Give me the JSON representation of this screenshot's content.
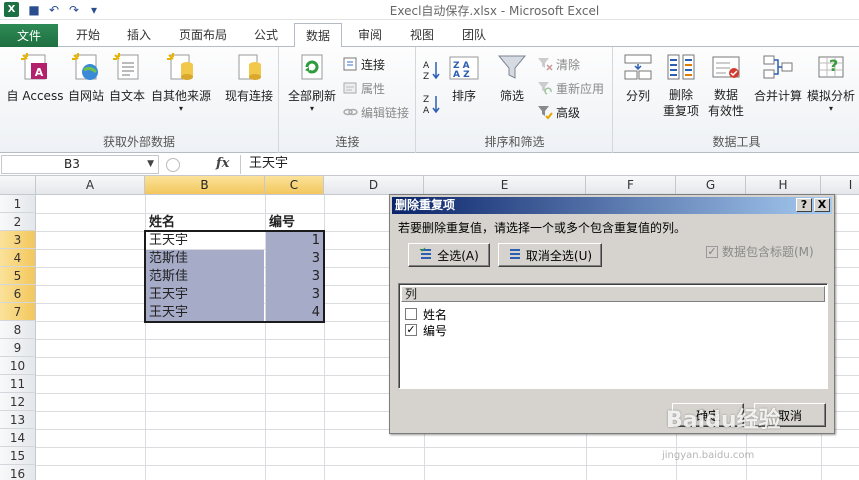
{
  "window": {
    "title": "Execl自动保存.xlsx  -  Microsoft Excel",
    "app_icon": "X"
  },
  "tabs": [
    "文件",
    "开始",
    "插入",
    "页面布局",
    "公式",
    "数据",
    "审阅",
    "视图",
    "团队"
  ],
  "ribbon": {
    "get_external": {
      "label": "获取外部数据",
      "buttons": [
        "自 Access",
        "自网站",
        "自文本",
        "自其他来源",
        "现有连接"
      ]
    },
    "connections": {
      "label": "连接",
      "refresh_all": "全部刷新",
      "items": [
        "连接",
        "属性",
        "编辑链接"
      ]
    },
    "sort_filter": {
      "label": "排序和筛选",
      "sort": "排序",
      "filter": "筛选",
      "items": [
        "清除",
        "重新应用",
        "高级"
      ]
    },
    "data_tools": {
      "label": "数据工具",
      "buttons": [
        "分列",
        "删除\n重复项",
        "数据\n有效性",
        "合并计算",
        "模拟分析"
      ]
    }
  },
  "formula_bar": {
    "name_box": "B3",
    "fx": "fx",
    "content": "王天宇"
  },
  "grid": {
    "columns": [
      "A",
      "B",
      "C",
      "D",
      "E",
      "F",
      "G",
      "H",
      "I"
    ],
    "rows": [
      "1",
      "2",
      "3",
      "4",
      "5",
      "6",
      "7",
      "8",
      "9",
      "10",
      "11",
      "12",
      "13",
      "14",
      "15",
      "16"
    ],
    "header": {
      "name": "姓名",
      "id": "编号"
    },
    "data": [
      {
        "name": "王天宇",
        "id": "1"
      },
      {
        "name": "范斯佳",
        "id": "3"
      },
      {
        "name": "范斯佳",
        "id": "3"
      },
      {
        "name": "王天宇",
        "id": "3"
      },
      {
        "name": "王天宇",
        "id": "4"
      }
    ]
  },
  "dialog": {
    "title": "删除重复项",
    "help": "?",
    "close": "X",
    "prompt": "若要删除重复值，请选择一个或多个包含重复值的列。",
    "select_all": "全选(A)",
    "unselect_all": "取消全选(U)",
    "has_headers": "数据包含标题(M)",
    "list_header": "列",
    "columns": [
      {
        "label": "姓名",
        "checked": false
      },
      {
        "label": "编号",
        "checked": true
      }
    ],
    "ok": "确定",
    "cancel": "取消"
  },
  "watermark": {
    "brand": "Baidu经验",
    "url": "jingyan.baidu.com"
  }
}
